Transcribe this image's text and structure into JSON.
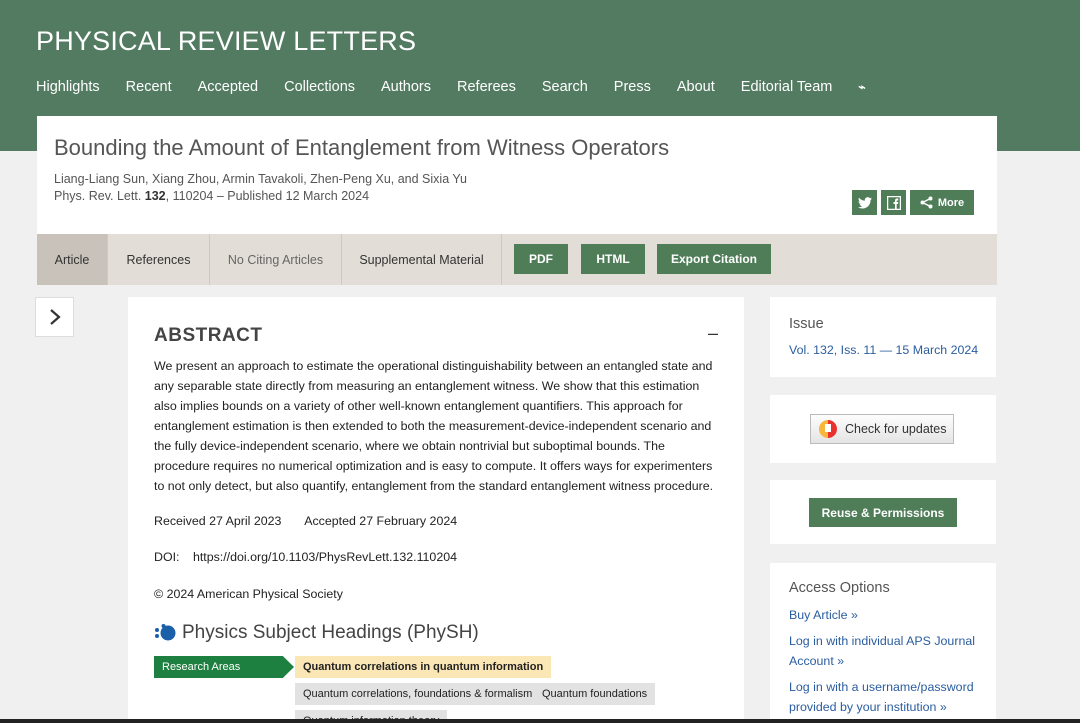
{
  "journal": {
    "title": "PHYSICAL REVIEW LETTERS"
  },
  "nav": {
    "items": [
      "Highlights",
      "Recent",
      "Accepted",
      "Collections",
      "Authors",
      "Referees",
      "Search",
      "Press",
      "About",
      "Editorial Team"
    ],
    "rss": "⌁"
  },
  "article": {
    "title": "Bounding the Amount of Entanglement from Witness Operators",
    "authors": "Liang-Liang Sun, Xiang Zhou, Armin Tavakoli, Zhen-Peng Xu, and Sixia Yu",
    "citation_prefix": "Phys. Rev. Lett. ",
    "volume": "132",
    "citation_suffix": ", 110204 – Published 12 March 2024"
  },
  "share": {
    "twitter": "t",
    "facebook": "f",
    "more": "More"
  },
  "tabs": {
    "article": "Article",
    "references": "References",
    "citing": "No Citing Articles",
    "supplemental": "Supplemental Material",
    "pdf": "PDF",
    "html": "HTML",
    "export": "Export Citation"
  },
  "abstract": {
    "heading": "ABSTRACT",
    "collapse": "–",
    "text": "We present an approach to estimate the operational distinguishability between an entangled state and any separable state directly from measuring an entanglement witness. We show that this estimation also implies bounds on a variety of other well-known entanglement quantifiers. This approach for entanglement estimation is then extended to both the measurement-device-independent scenario and the fully device-independent scenario, where we obtain nontrivial but suboptimal bounds. The procedure requires no numerical optimization and is easy to compute. It offers ways for experimenters to not only detect, but also quantify, entanglement from the standard entanglement witness procedure.",
    "received": "Received 27 April 2023",
    "accepted": "Accepted 27 February 2024",
    "doi_label": "DOI:",
    "doi": "https://doi.org/10.1103/PhysRevLett.132.110204",
    "copyright": "© 2024 American Physical Society"
  },
  "physh": {
    "title": "Physics Subject Headings (PhySH)",
    "research_areas_label": "Research Areas",
    "primary": "Quantum correlations in quantum information",
    "chips": [
      "Quantum correlations, foundations & formalism",
      "Quantum foundations",
      "Quantum information theory"
    ]
  },
  "sidebar": {
    "issue_heading": "Issue",
    "issue_link": "Vol. 132, Iss. 11 — 15 March 2024",
    "check_updates": "Check for updates",
    "reuse": "Reuse & Permissions",
    "access_heading": "Access Options",
    "access_links": [
      "Buy Article »",
      "Log in with individual APS Journal Account »",
      "Log in with a username/password provided by your institution »"
    ]
  },
  "colors": {
    "brand_green": "#537b61",
    "button_green": "#4e7d58",
    "link_blue": "#2a5d9f",
    "tab_bg": "#e2ddd6"
  }
}
